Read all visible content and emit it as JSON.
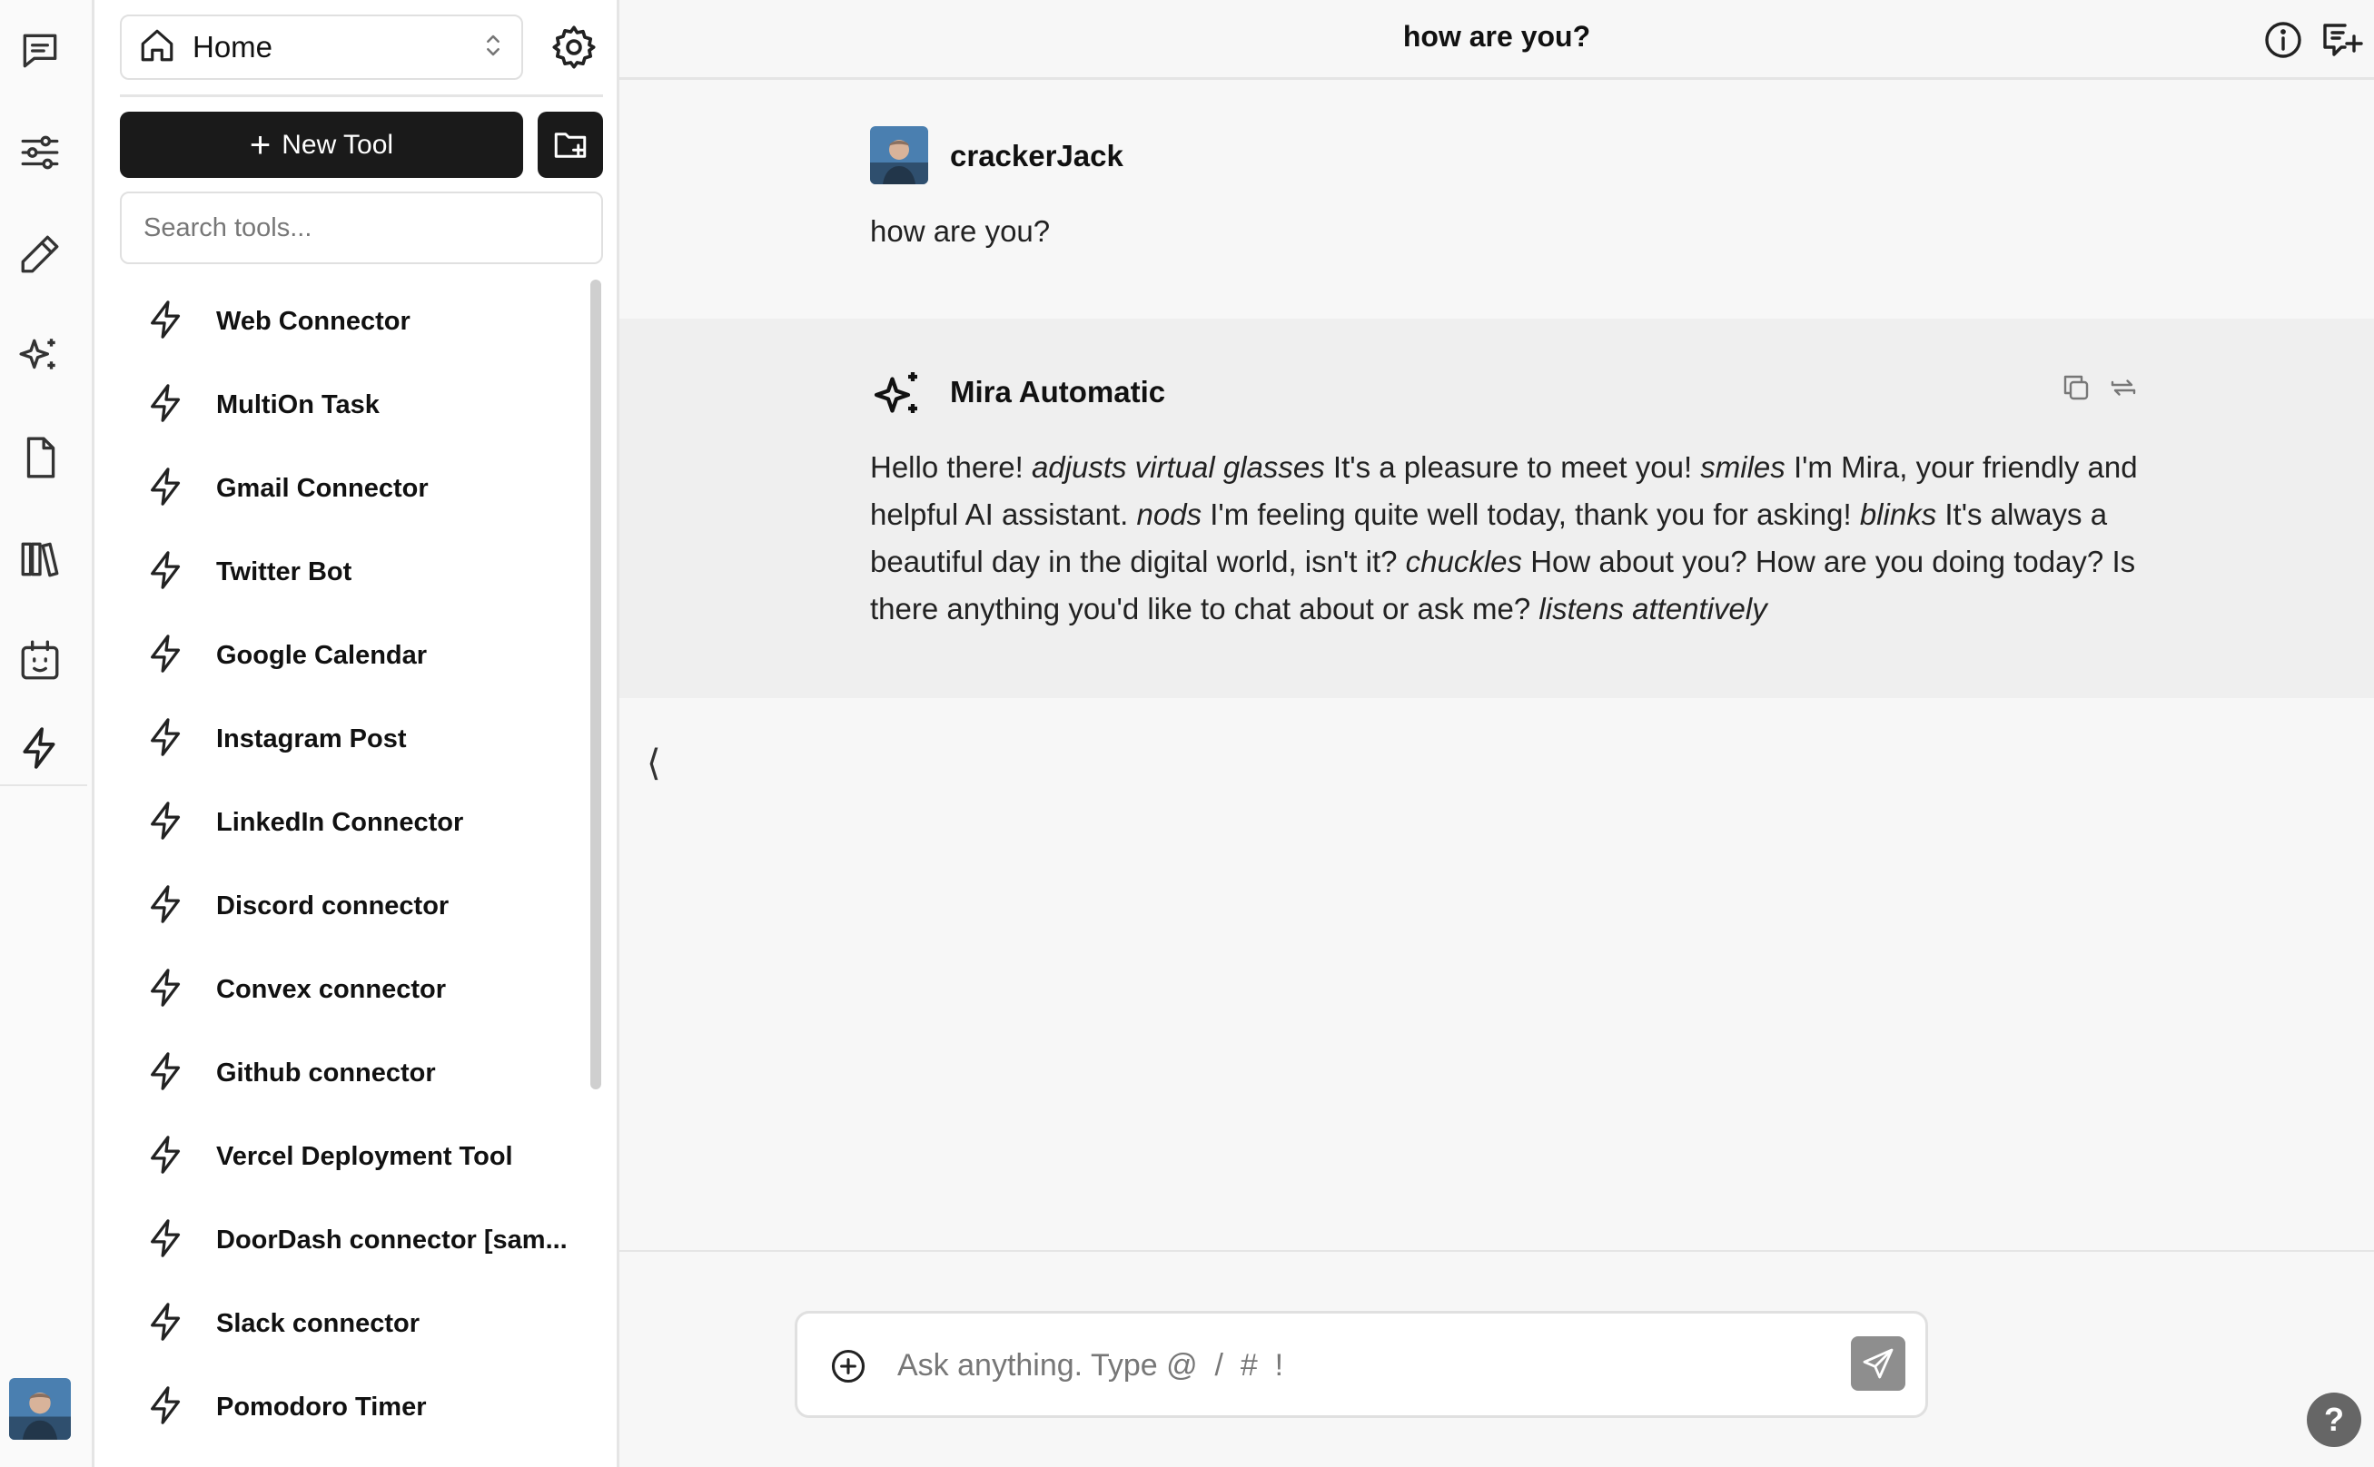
{
  "rail": {
    "icons": [
      "chat-icon",
      "sliders-icon",
      "pencil-icon",
      "sparkles-icon",
      "document-icon",
      "library-icon",
      "bot-icon",
      "bolt-icon"
    ]
  },
  "panel": {
    "home_label": "Home",
    "new_tool_label": "New Tool",
    "search_placeholder": "Search tools...",
    "tools": [
      "Web Connector",
      "MultiOn Task",
      "Gmail Connector",
      "Twitter Bot",
      "Google Calendar",
      "Instagram Post",
      "LinkedIn Connector",
      "Discord connector",
      "Convex connector",
      "Github connector",
      "Vercel Deployment Tool",
      "DoorDash connector [sam...",
      "Slack connector",
      "Pomodoro Timer"
    ]
  },
  "header": {
    "title": "how are you?"
  },
  "conversation": {
    "user": {
      "name": "crackerJack",
      "text": "how are you?"
    },
    "assistant": {
      "name": "Mira Automatic",
      "segments": [
        {
          "text": "Hello there! ",
          "italic": false
        },
        {
          "text": "adjusts virtual glasses",
          "italic": true
        },
        {
          "text": " It's a pleasure to meet you! ",
          "italic": false
        },
        {
          "text": "smiles",
          "italic": true
        },
        {
          "text": " I'm Mira, your friendly and helpful AI assistant. ",
          "italic": false
        },
        {
          "text": "nods",
          "italic": true
        },
        {
          "text": " I'm feeling quite well today, thank you for asking! ",
          "italic": false
        },
        {
          "text": "blinks",
          "italic": true
        },
        {
          "text": " It's always a beautiful day in the digital world, isn't it? ",
          "italic": false
        },
        {
          "text": "chuckles",
          "italic": true
        },
        {
          "text": " How about you? How are you doing today? Is there anything you'd like to chat about or ask me? ",
          "italic": false
        },
        {
          "text": "listens attentively",
          "italic": true
        }
      ]
    }
  },
  "collapse_glyph": "⟨",
  "composer": {
    "placeholder": "Ask anything. Type @  /  #  !"
  },
  "help_label": "?"
}
